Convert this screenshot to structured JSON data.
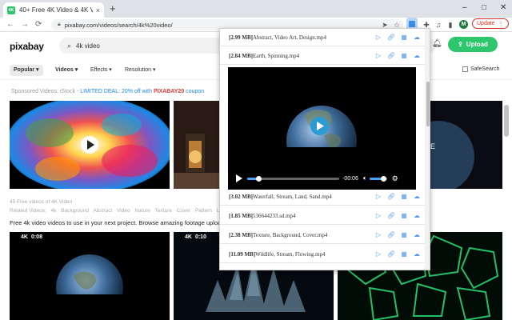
{
  "browser": {
    "tab_title": "40+ Free 4K Video & 4K Vi",
    "tab_favicon": "4K",
    "tab_close": "×",
    "new_tab": "+",
    "minimize": "–",
    "maximize": "□",
    "close": "✕",
    "url": "pixabay.com/videos/search/4k%20video/",
    "profile_initial": "M",
    "update_label": "Update",
    "back": "←",
    "forward": "→",
    "reload": "⟳"
  },
  "site": {
    "logo": "pixabay",
    "search_value": "4k video",
    "upload_label": "Upload",
    "filters": [
      "Popular",
      "Videos",
      "Effects",
      "Resolution"
    ],
    "safesearch_label": "SafeSearch",
    "sponsored_prefix": "Sponsored Videos: iStock - ",
    "sponsored_deal": "LIMITED DEAL: 20% off with ",
    "sponsored_code": "PIXABAY20",
    "sponsored_suffix": " coupon",
    "free_info": "45 Free videos of 4K Video",
    "related_label": "Related Videos:",
    "related_tags": [
      "4k",
      "Background",
      "Abstract",
      "Video",
      "Nature",
      "Texture",
      "Cover",
      "Pattern",
      "Live"
    ],
    "description": "Free 4k video videos to use in your next project. Browse amazing footage upload",
    "videos": [
      {
        "quality": "4K",
        "duration": "0:08"
      },
      {
        "quality": "4K",
        "duration": "0:10"
      }
    ]
  },
  "popup": {
    "rows_top": [
      {
        "size": "[2.99 MB]",
        "name": "Abstract, Video Art, Design.mp4"
      },
      {
        "size": "[2.84 MB]",
        "name": "Earth, Spinning.mp4"
      }
    ],
    "rows_bottom": [
      {
        "size": "[3.02 MB]",
        "name": "Waterfall, Stream, Land, Sand.mp4"
      },
      {
        "size": "[1.85 MB]",
        "name": "536644233.sd.mp4"
      },
      {
        "size": "[2.38 MB]",
        "name": "Texture, Background, Cover.mp4"
      },
      {
        "size": "[11.09 MB]",
        "name": "Wildlife, Stream, Flowing.mp4"
      }
    ],
    "player": {
      "time_remaining": "-00:06",
      "progress": 0.12,
      "volume": 0.8
    }
  }
}
